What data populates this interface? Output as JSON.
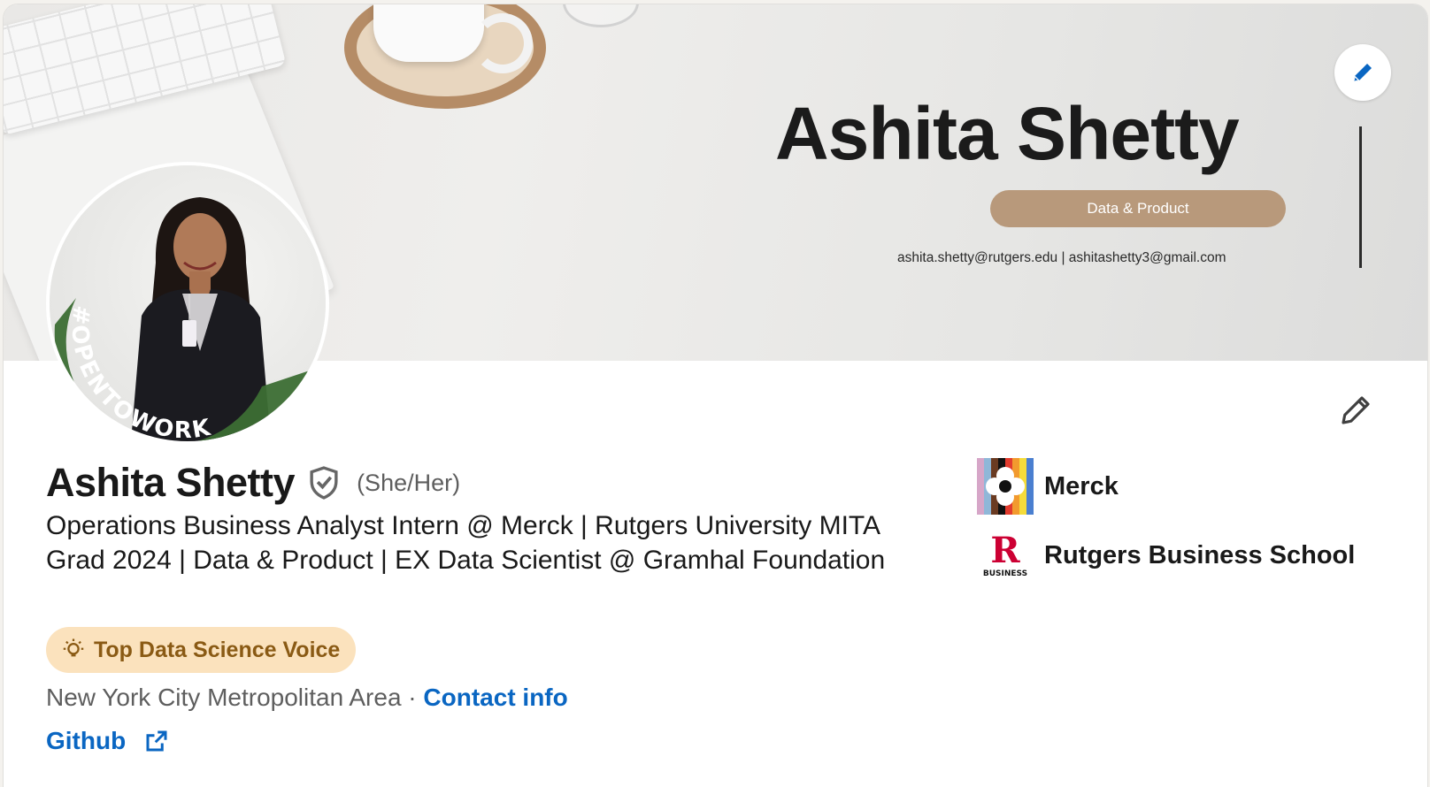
{
  "banner": {
    "name": "Ashita Shetty",
    "tagline": "Data & Product",
    "emails": "ashita.shetty@rutgers.edu  | ashitashetty3@gmail.com"
  },
  "avatar": {
    "frame_text": "#OPENTOWORK",
    "frame_color": "#3c6e34"
  },
  "profile": {
    "name": "Ashita Shetty",
    "pronouns": "(She/Her)",
    "headline": "Operations Business Analyst Intern @ Merck | Rutgers University MITA Grad 2024 | Data & Product | EX Data Scientist @ Gramhal Foundation",
    "badge": "Top Data Science Voice",
    "location": "New York City Metropolitan Area",
    "separator": " · ",
    "contact_label": "Contact info",
    "link_label": "Github"
  },
  "orgs": [
    {
      "name": "Merck",
      "icon": "merck-logo"
    },
    {
      "name": "Rutgers Business School",
      "icon": "rutgers-logo"
    }
  ],
  "icons": {
    "banner_edit": "pencil-icon",
    "intro_edit": "pencil-icon",
    "verified": "shield-check-icon",
    "badge": "lightbulb-icon",
    "external": "external-link-icon"
  },
  "colors": {
    "link": "#0a66c2",
    "badge_bg": "#fbe2bd",
    "badge_text": "#8a5a14",
    "opentowork": "#3c6e34"
  },
  "rutgers_logo_text": {
    "letter": "R",
    "caption": "BUSINESS"
  }
}
